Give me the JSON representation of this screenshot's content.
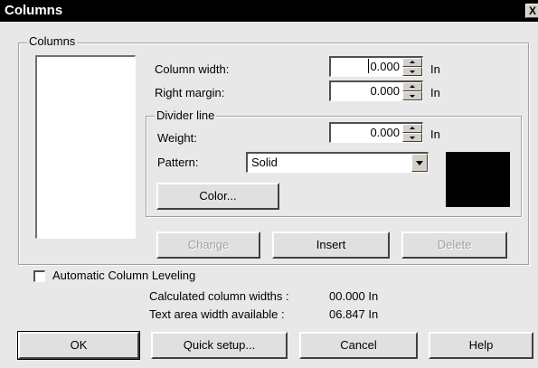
{
  "dialog": {
    "title": "Columns",
    "close_glyph": "X"
  },
  "columns_group": {
    "legend": "Columns",
    "column_width": {
      "label": "Column width:",
      "value": "0.000",
      "unit": "In"
    },
    "right_margin": {
      "label": "Right margin:",
      "value": "0.000",
      "unit": "In"
    },
    "divider": {
      "legend": "Divider line",
      "weight": {
        "label": "Weight:",
        "value": "0.000",
        "unit": "In"
      },
      "pattern": {
        "label": "Pattern:",
        "value": "Solid"
      },
      "color_button": "Color...",
      "swatch_color": "#000000"
    },
    "buttons": {
      "change": "Change",
      "insert": "Insert",
      "delete": "Delete"
    }
  },
  "auto_leveling": {
    "label": "Automatic Column Leveling",
    "checked": false
  },
  "info": {
    "calc_label": "Calculated column widths :",
    "calc_value": "00.000 In",
    "text_label": "Text area width available :",
    "text_value": "06.847 In"
  },
  "footer": {
    "ok": "OK",
    "quick_setup": "Quick setup...",
    "cancel": "Cancel",
    "help": "Help"
  }
}
